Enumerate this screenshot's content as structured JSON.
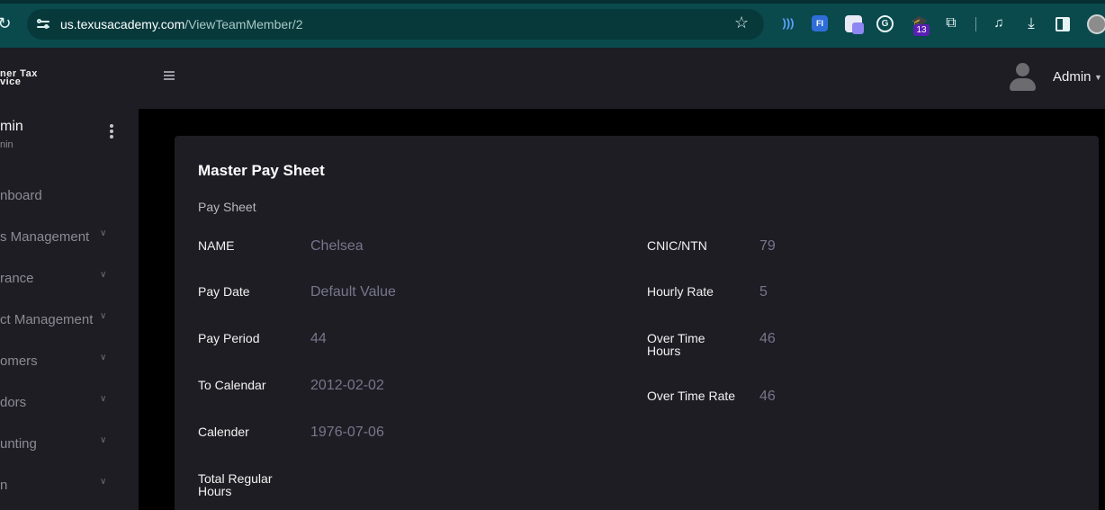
{
  "browser": {
    "url_host": "us.texusacademy.com",
    "url_path": "/ViewTeamMember/2",
    "reload_icon": "reload-icon",
    "extension_badge": "13",
    "extension_fi_label": "FI",
    "extension_g_label": "G"
  },
  "sidebar": {
    "brand_line1": "ner Tax",
    "brand_line2": "vice",
    "user_name": "min",
    "user_role": "nin",
    "items": [
      {
        "label": "nboard",
        "has_chevron": false
      },
      {
        "label": "s Management",
        "has_chevron": true
      },
      {
        "label": "rance",
        "has_chevron": true
      },
      {
        "label": "ct Management",
        "has_chevron": true
      },
      {
        "label": "omers",
        "has_chevron": true
      },
      {
        "label": "dors",
        "has_chevron": true
      },
      {
        "label": "unting",
        "has_chevron": true
      },
      {
        "label": "n",
        "has_chevron": true
      }
    ]
  },
  "topbar": {
    "admin_label": "Admin"
  },
  "card": {
    "title": "Master Pay Sheet",
    "subtitle": "Pay Sheet",
    "left_fields": [
      {
        "label": "NAME",
        "value": "Chelsea"
      },
      {
        "label": "Pay Date",
        "value": "Default Value"
      },
      {
        "label": "Pay Period",
        "value": "44"
      },
      {
        "label": "To Calendar",
        "value": "2012-02-02"
      },
      {
        "label": "Calender",
        "value": "1976-07-06"
      },
      {
        "label": "Total Regular Hours",
        "value": ""
      }
    ],
    "right_fields": [
      {
        "label": "CNIC/NTN",
        "value": "79"
      },
      {
        "label": "Hourly Rate",
        "value": "5"
      },
      {
        "label": "Over Time Hours",
        "value": "46"
      },
      {
        "label": "Over Time Rate",
        "value": "46"
      }
    ]
  },
  "colors": {
    "sidebar_bg": "#1e1d24",
    "page_bg": "#000000",
    "chrome_bg": "#0a4a4d",
    "value_text": "#77768a"
  }
}
